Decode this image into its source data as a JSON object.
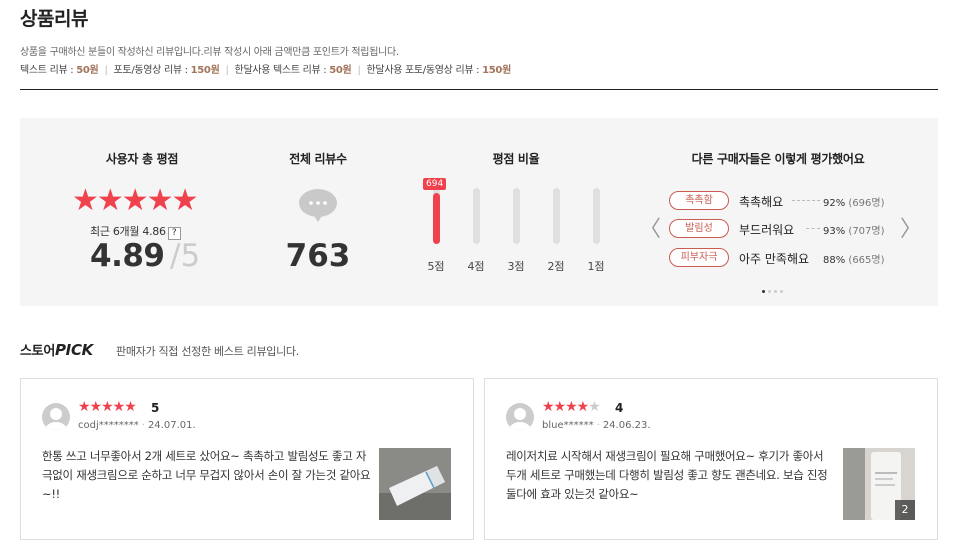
{
  "header": {
    "title": "상품리뷰",
    "description": "상품을 구매하신 분들이 작성하신 리뷰입니다.리뷰 작성시 아래 금액만큼 포인트가 적립됩니다.",
    "points": [
      {
        "label": "텍스트 리뷰 : ",
        "amount": "50원"
      },
      {
        "label": "포토/동영상 리뷰 : ",
        "amount": "150원"
      },
      {
        "label": "한달사용 텍스트 리뷰 : ",
        "amount": "50원"
      },
      {
        "label": "한달사용 포토/동영상 리뷰 : ",
        "amount": "150원"
      }
    ]
  },
  "summary": {
    "rating": {
      "heading": "사용자 총 평점",
      "stars": "★★★★★",
      "recent_label": "최근 6개월 4.86",
      "help": "?",
      "average": "4.89",
      "max": "/5"
    },
    "total": {
      "heading": "전체 리뷰수",
      "count": "763"
    },
    "distribution": {
      "heading": "평점 비율",
      "top_count": "694",
      "bars": [
        {
          "label": "5점",
          "fraction": 0.91
        },
        {
          "label": "4점",
          "fraction": 0.0
        },
        {
          "label": "3점",
          "fraction": 0.0
        },
        {
          "label": "2점",
          "fraction": 0.0
        },
        {
          "label": "1점",
          "fraction": 0.0
        }
      ]
    },
    "evaluation": {
      "heading": "다른 구매자들은 이렇게 평가했어요",
      "prev": "〈",
      "next": "〉",
      "items": [
        {
          "tag": "촉촉함",
          "text": "촉촉해요",
          "pct": "92%",
          "count": "(696명)"
        },
        {
          "tag": "발림성",
          "text": "부드러워요",
          "pct": "93%",
          "count": "(707명)"
        },
        {
          "tag": "피부자극",
          "text": "아주 만족해요",
          "pct": "88%",
          "count": "(665명)"
        }
      ]
    }
  },
  "pick": {
    "title_prefix": "스토어",
    "title_strong": "PICK",
    "subtitle": "판매자가 직접 선정한 베스트 리뷰입니다."
  },
  "reviews": [
    {
      "stars_on": "★★★★★",
      "stars_off": "",
      "score": "5",
      "user": "codj********",
      "date": "24.07.01.",
      "body": "한통 쓰고 너무좋아서 2개 세트로 샀어요~ 촉촉하고 발림성도 좋고 자극없이 재생크림으로 순하고 너무 무겁지 않아서 손이 잘 가는것 같아요~!!",
      "photo_count": ""
    },
    {
      "stars_on": "★★★★",
      "stars_off": "★",
      "score": "4",
      "user": "blue******",
      "date": "24.06.23.",
      "body": "레이저치료 시작해서 재생크림이 필요해 구매했어요~ 후기가 좋아서 두개 세트로 구매했는데 다행히 발림성 좋고 향도 괜츤네요. 보습 진정 둘다에 효과 있는것 같아요~",
      "photo_count": "2"
    }
  ],
  "colors": {
    "accent": "#f0424d",
    "point": "#a3745b",
    "tag": "#c95b50"
  }
}
